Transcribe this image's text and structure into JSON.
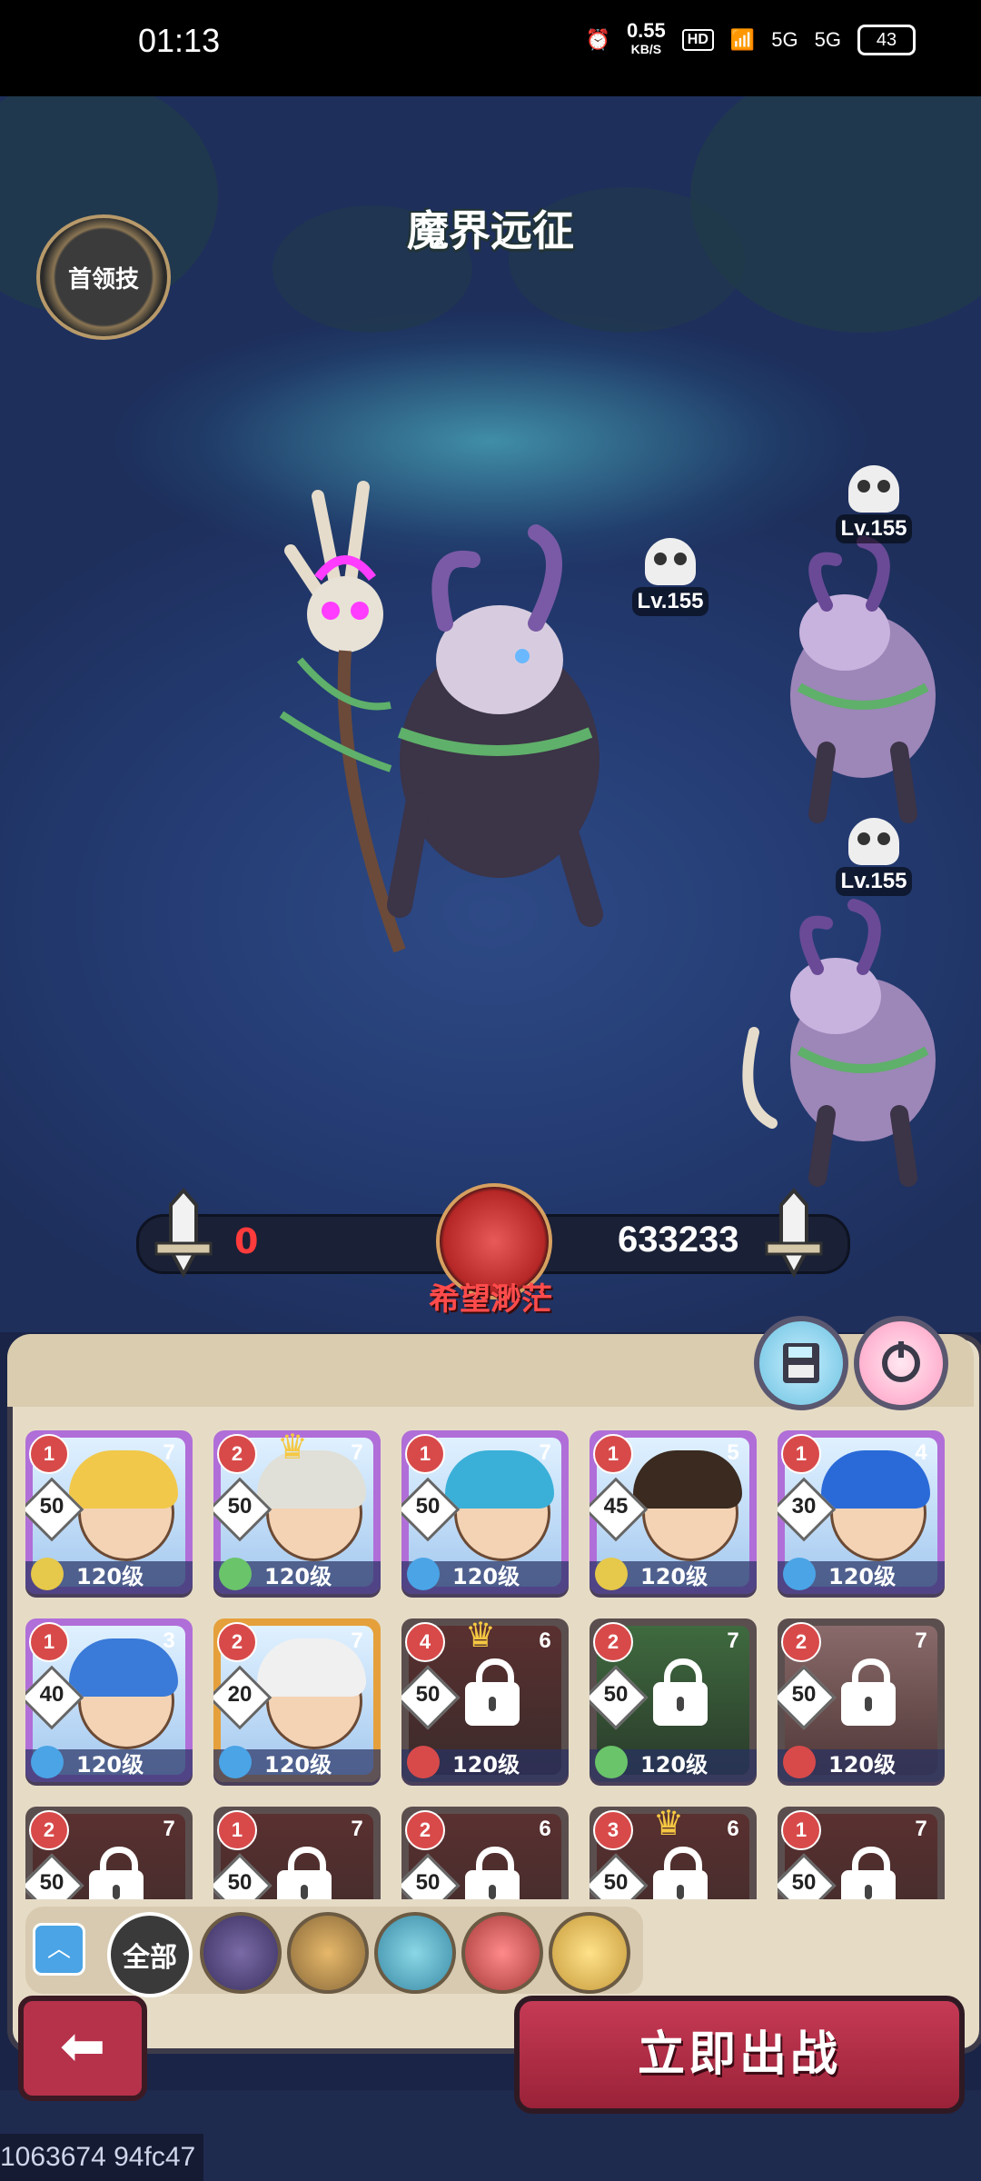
{
  "status_bar": {
    "time": "01:13",
    "net_speed": "0.55",
    "net_unit": "KB/S",
    "hd_label": "HD",
    "signal1": "5G",
    "signal2": "5G",
    "battery": "43",
    "icons": [
      "alarm-icon",
      "wifi-icon",
      "signal-icon",
      "signal-icon",
      "battery-icon"
    ]
  },
  "stage": {
    "title": "魔界远征",
    "boss_skill_label": "首领技"
  },
  "enemies": [
    {
      "level": "Lv.155"
    },
    {
      "level": "Lv.155"
    },
    {
      "level": "Lv.155"
    }
  ],
  "battle": {
    "our_power": "0",
    "enemy_power": "633233",
    "status": "希望渺茫"
  },
  "heroes": [
    {
      "rank": "1",
      "stars": "7",
      "stat": "50",
      "level": "120级",
      "element": "earth",
      "locked": false
    },
    {
      "rank": "2",
      "stars": "7",
      "stat": "50",
      "level": "120级",
      "element": "wind",
      "locked": false,
      "crown": true
    },
    {
      "rank": "1",
      "stars": "7",
      "stat": "50",
      "level": "120级",
      "element": "water",
      "locked": false
    },
    {
      "rank": "1",
      "stars": "5",
      "stat": "45",
      "level": "120级",
      "element": "earth",
      "locked": false
    },
    {
      "rank": "1",
      "stars": "4",
      "stat": "30",
      "level": "120级",
      "element": "water",
      "locked": false
    },
    {
      "rank": "1",
      "stars": "3",
      "stat": "40",
      "level": "120级",
      "element": "water",
      "locked": false
    },
    {
      "rank": "2",
      "stars": "7",
      "stat": "20",
      "level": "120级",
      "element": "water",
      "locked": false
    },
    {
      "rank": "4",
      "stars": "6",
      "stat": "50",
      "level": "120级",
      "element": "fire",
      "locked": true,
      "crown": true
    },
    {
      "rank": "2",
      "stars": "7",
      "stat": "50",
      "level": "120级",
      "element": "wind",
      "locked": true
    },
    {
      "rank": "2",
      "stars": "7",
      "stat": "50",
      "level": "120级",
      "element": "fire",
      "locked": true
    },
    {
      "rank": "2",
      "stars": "7",
      "stat": "50",
      "locked": true
    },
    {
      "rank": "1",
      "stars": "7",
      "stat": "50",
      "locked": true
    },
    {
      "rank": "2",
      "stars": "6",
      "stat": "50",
      "locked": true
    },
    {
      "rank": "3",
      "stars": "6",
      "stat": "50",
      "locked": true,
      "crown": true
    },
    {
      "rank": "1",
      "stars": "7",
      "stat": "50",
      "locked": true
    }
  ],
  "filters": {
    "all_label": "全部",
    "icons": [
      "dark-faction-icon",
      "earth-faction-icon",
      "wind-faction-icon",
      "fire-faction-icon",
      "light-faction-icon"
    ]
  },
  "actions": {
    "deploy_label": "立即出战"
  },
  "debug": {
    "build_text": "1063674 94fc47"
  },
  "colors": {
    "accent_red": "#b6314a",
    "enemy_power_red": "#ff3b3b",
    "panel_bg": "#e6dcc6"
  }
}
